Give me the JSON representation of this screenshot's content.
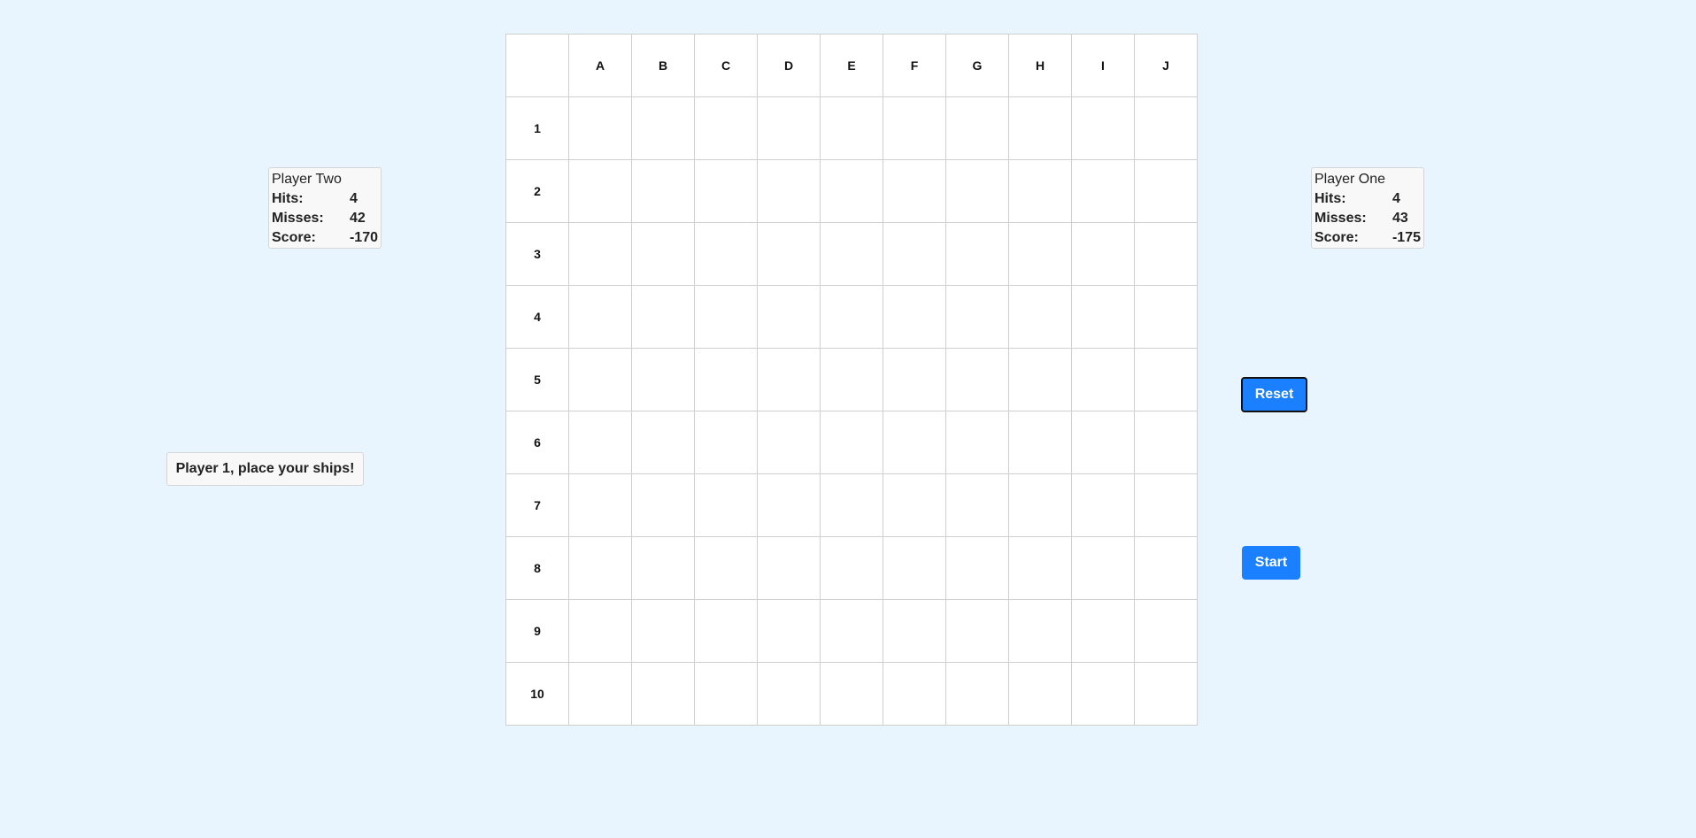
{
  "board": {
    "columns": [
      "A",
      "B",
      "C",
      "D",
      "E",
      "F",
      "G",
      "H",
      "I",
      "J"
    ],
    "rows": [
      "1",
      "2",
      "3",
      "4",
      "5",
      "6",
      "7",
      "8",
      "9",
      "10"
    ]
  },
  "player_two": {
    "title": "Player Two",
    "hits_label": "Hits:",
    "hits": "4",
    "misses_label": "Misses:",
    "misses": "42",
    "score_label": "Score:",
    "score": "-170"
  },
  "player_one": {
    "title": "Player One",
    "hits_label": "Hits:",
    "hits": "4",
    "misses_label": "Misses:",
    "misses": "43",
    "score_label": "Score:",
    "score": "-175"
  },
  "status": {
    "message": "Player 1, place your ships!"
  },
  "controls": {
    "reset_label": "Reset",
    "start_label": "Start"
  },
  "colors": {
    "background": "#e8f5fe",
    "button": "#1a80ff"
  }
}
